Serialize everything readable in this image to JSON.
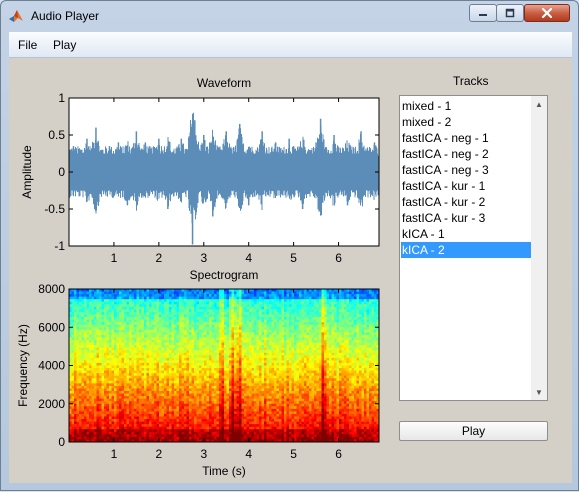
{
  "window": {
    "title": "Audio Player"
  },
  "menu": [
    "File",
    "Play"
  ],
  "waveform": {
    "title": "Waveform",
    "ylabel": "Amplitude",
    "yticks": [
      "1",
      "0.5",
      "0",
      "-0.5",
      "-1"
    ],
    "xticks": [
      "1",
      "2",
      "3",
      "4",
      "5",
      "6"
    ]
  },
  "spectrogram": {
    "title": "Spectrogram",
    "ylabel": "Frequency (Hz)",
    "xlabel": "Time (s)",
    "yticks": [
      "8000",
      "6000",
      "4000",
      "2000",
      "0"
    ],
    "xticks": [
      "1",
      "2",
      "3",
      "4",
      "5",
      "6"
    ]
  },
  "tracks": {
    "title": "Tracks",
    "items": [
      "mixed - 1",
      "mixed - 2",
      "fastICA - neg - 1",
      "fastICA - neg - 2",
      "fastICA - neg - 3",
      "fastICA - kur - 1",
      "fastICA - kur - 2",
      "fastICA - kur - 3",
      "kICA - 1",
      "kICA - 2"
    ],
    "selected": "kICA - 2"
  },
  "play_button": "Play",
  "chart_data": [
    {
      "type": "line",
      "title": "Waveform",
      "ylabel": "Amplitude",
      "xlabel": "",
      "xlim": [
        0,
        6.9
      ],
      "ylim": [
        -1,
        1
      ],
      "xticks": [
        1,
        2,
        3,
        4,
        5,
        6
      ],
      "yticks": [
        -1,
        -0.5,
        0,
        0.5,
        1
      ],
      "color": "#5b8db8",
      "series": [
        {
          "x": [
            0.1,
            0.4,
            0.4,
            0.6,
            0.9,
            1.1,
            1.3,
            1.5,
            1.7,
            2.0,
            2.2,
            2.5,
            2.8,
            2.75,
            3.0,
            3.2,
            3.5,
            3.8,
            4.0,
            4.3,
            4.6,
            4.9,
            5.2,
            5.5,
            5.6,
            5.9,
            6.2,
            6.5,
            6.8
          ],
          "y": [
            0.35,
            0.45,
            -0.4,
            0.6,
            0.35,
            0.4,
            -0.45,
            0.55,
            0.4,
            0.45,
            -0.5,
            0.45,
            0.7,
            -0.98,
            0.5,
            -0.6,
            0.55,
            0.65,
            -0.45,
            0.55,
            0.4,
            0.45,
            -0.5,
            0.4,
            0.72,
            0.5,
            -0.45,
            0.55,
            0.4
          ]
        }
      ]
    },
    {
      "type": "heatmap",
      "title": "Spectrogram",
      "xlabel": "Time (s)",
      "ylabel": "Frequency (Hz)",
      "xlim": [
        0,
        6.9
      ],
      "ylim": [
        0,
        8000
      ],
      "xticks": [
        1,
        2,
        3,
        4,
        5,
        6
      ],
      "yticks": [
        0,
        2000,
        4000,
        6000,
        8000
      ],
      "colormap": "jet"
    }
  ]
}
